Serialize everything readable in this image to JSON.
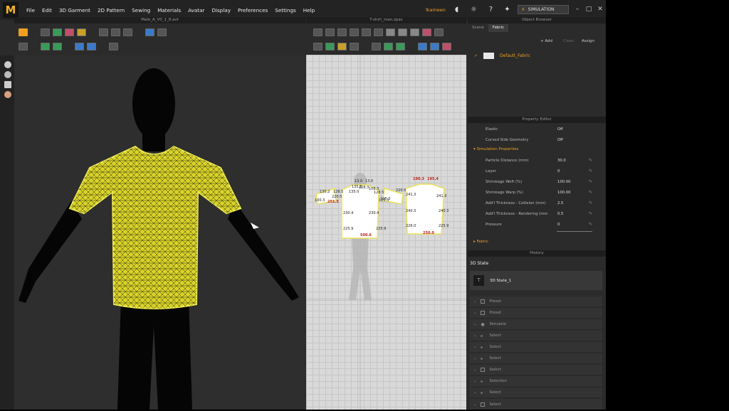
{
  "menu": [
    "File",
    "Edit",
    "3D Garment",
    "2D Pattern",
    "Sewing",
    "Materials",
    "Avatar",
    "Display",
    "Preferences",
    "Settings",
    "Help"
  ],
  "user": "lkameen",
  "simulation_label": "SIMULATION",
  "view3d_title": "Male_A_V0_1_8.avt",
  "view2d_title": "T-shirt_man.zpac",
  "object_browser": {
    "title": "Object Browser",
    "tabs": [
      "Scene",
      "Fabric"
    ],
    "add": "+ Add",
    "clean": "Clean",
    "assign": "Assign",
    "fabric": "Default_Fabric"
  },
  "property_editor": {
    "title": "Property Editor",
    "rows": [
      {
        "label": "Elastic",
        "value": "Off"
      },
      {
        "label": "Curved Side Geometry",
        "value": "Off"
      }
    ],
    "sim_section": "Simulation Properties",
    "sim_rows": [
      {
        "label": "Particle Distance (mm)",
        "value": "30.0"
      },
      {
        "label": "Layer",
        "value": "0"
      },
      {
        "label": "Shrinkage Weft (%)",
        "value": "100.00"
      },
      {
        "label": "Shrinkage Warp (%)",
        "value": "100.00"
      },
      {
        "label": "Add'l Thickness - Collision (mm)",
        "value": "2.5"
      },
      {
        "label": "Add'l Thickness - Rendering (mm",
        "value": "0.5"
      },
      {
        "label": "Pressure",
        "value": "0"
      }
    ],
    "fabric_section": "Fabric"
  },
  "history": {
    "title": "History",
    "state_header": "3D State",
    "state_item": "3D State_1",
    "items": [
      "Preset",
      "Preset",
      "Simulate",
      "Select",
      "Select",
      "Select",
      "Select",
      "Selection",
      "Select",
      "Select"
    ]
  },
  "patterns": {
    "labels": [
      "13.0",
      "13.0",
      "228.3",
      "106.3",
      "100.3",
      "135.0",
      "128.5",
      "130.2",
      "128.5",
      "106.3",
      "230.4",
      "230.4",
      "225.9",
      "225.9",
      "220.5",
      "220.5",
      "241.3",
      "241.3",
      "240.3",
      "240.3",
      "226.0",
      "225.9",
      "135.8",
      "125.3",
      "251.5",
      "500.6",
      "250.0",
      "190.3",
      "195.4"
    ]
  }
}
